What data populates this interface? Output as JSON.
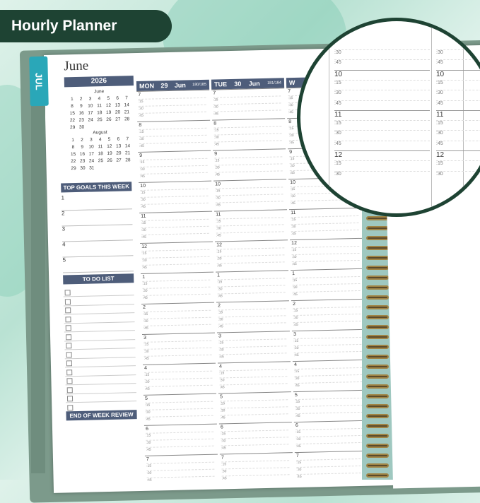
{
  "badge": "Hourly Planner",
  "tab_label": "JUL",
  "month_title": "June",
  "year": "2026",
  "mini_cals": [
    {
      "name": "June",
      "days": [
        "1",
        "2",
        "3",
        "4",
        "5",
        "6",
        "7",
        "8",
        "9",
        "10",
        "11",
        "12",
        "13",
        "14",
        "15",
        "16",
        "17",
        "18",
        "19",
        "20",
        "21",
        "22",
        "23",
        "24",
        "25",
        "26",
        "27",
        "28",
        "29",
        "30"
      ]
    },
    {
      "name": "August",
      "days": [
        "1",
        "2",
        "3",
        "4",
        "5",
        "6",
        "7",
        "8",
        "9",
        "10",
        "11",
        "12",
        "13",
        "14",
        "15",
        "16",
        "17",
        "18",
        "19",
        "20",
        "21",
        "22",
        "23",
        "24",
        "25",
        "26",
        "27",
        "28",
        "29",
        "30",
        "31"
      ]
    }
  ],
  "sections": {
    "goals": "TOP GOALS THIS WEEK",
    "todo": "TO DO LIST",
    "review": "END OF WEEK REVIEW"
  },
  "goal_numbers": [
    "1",
    "2",
    "3",
    "4",
    "5"
  ],
  "days": [
    {
      "dow": "MON",
      "date": "29",
      "mon": "Jun",
      "count": "180/185"
    },
    {
      "dow": "TUE",
      "date": "30",
      "mon": "Jun",
      "count": "181/184"
    },
    {
      "dow": "W",
      "date": "",
      "mon": "",
      "count": ""
    }
  ],
  "hours": [
    "7",
    "8",
    "9",
    "10",
    "11",
    "12",
    "1",
    "2",
    "3",
    "4",
    "5",
    "6",
    "7"
  ],
  "quarters": [
    ":15",
    ":30",
    ":45"
  ],
  "magnifier": {
    "rows": [
      {
        "label": ":30",
        "cls": "q"
      },
      {
        "label": ":45",
        "cls": "q"
      },
      {
        "label": "10",
        "cls": "h"
      },
      {
        "label": ":15",
        "cls": "q"
      },
      {
        "label": ":30",
        "cls": "q"
      },
      {
        "label": ":45",
        "cls": "q"
      },
      {
        "label": "11",
        "cls": "h"
      },
      {
        "label": ":15",
        "cls": "q"
      },
      {
        "label": ":30",
        "cls": "q"
      },
      {
        "label": ":45",
        "cls": "q"
      },
      {
        "label": "12",
        "cls": "h"
      },
      {
        "label": ":15",
        "cls": "q"
      },
      {
        "label": ":30",
        "cls": "q"
      }
    ]
  },
  "colors": {
    "header": "#4e5d7a",
    "badge": "#1e4333",
    "tab": "#2aa7b8"
  }
}
